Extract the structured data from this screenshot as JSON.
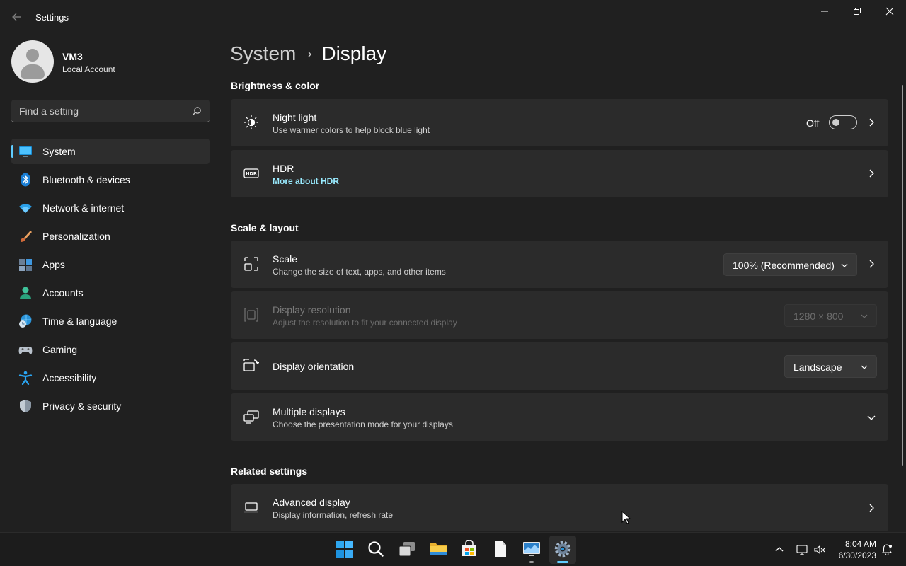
{
  "window": {
    "app_title": "Settings"
  },
  "profile": {
    "name": "VM3",
    "account_type": "Local Account"
  },
  "search": {
    "placeholder": "Find a setting",
    "icon": "search-icon"
  },
  "sidebar": {
    "items": [
      {
        "label": "System",
        "icon": "system-icon",
        "active": true
      },
      {
        "label": "Bluetooth & devices",
        "icon": "bluetooth-icon"
      },
      {
        "label": "Network & internet",
        "icon": "wifi-icon"
      },
      {
        "label": "Personalization",
        "icon": "brush-icon"
      },
      {
        "label": "Apps",
        "icon": "apps-icon"
      },
      {
        "label": "Accounts",
        "icon": "accounts-icon"
      },
      {
        "label": "Time & language",
        "icon": "globe-clock-icon"
      },
      {
        "label": "Gaming",
        "icon": "gamepad-icon"
      },
      {
        "label": "Accessibility",
        "icon": "accessibility-icon"
      },
      {
        "label": "Privacy & security",
        "icon": "shield-icon"
      }
    ]
  },
  "breadcrumb": {
    "parent": "System",
    "separator": "›",
    "current": "Display"
  },
  "sections": {
    "brightness": "Brightness & color",
    "scale_layout": "Scale & layout",
    "related": "Related settings"
  },
  "cards": {
    "night_light": {
      "title": "Night light",
      "subtitle": "Use warmer colors to help block blue light",
      "toggle_state": "Off"
    },
    "hdr": {
      "title": "HDR",
      "link": "More about HDR"
    },
    "scale": {
      "title": "Scale",
      "subtitle": "Change the size of text, apps, and other items",
      "value": "100% (Recommended)"
    },
    "resolution": {
      "title": "Display resolution",
      "subtitle": "Adjust the resolution to fit your connected display",
      "value": "1280 × 800"
    },
    "orientation": {
      "title": "Display orientation",
      "value": "Landscape"
    },
    "multiple": {
      "title": "Multiple displays",
      "subtitle": "Choose the presentation mode for your displays"
    },
    "advanced": {
      "title": "Advanced display",
      "subtitle": "Display information, refresh rate"
    }
  },
  "taskbar": {
    "time": "8:04 AM",
    "date": "6/30/2023"
  },
  "colors": {
    "accent": "#60cdff",
    "link": "#99ebff",
    "background": "#202020",
    "card": "#2b2b2b"
  }
}
